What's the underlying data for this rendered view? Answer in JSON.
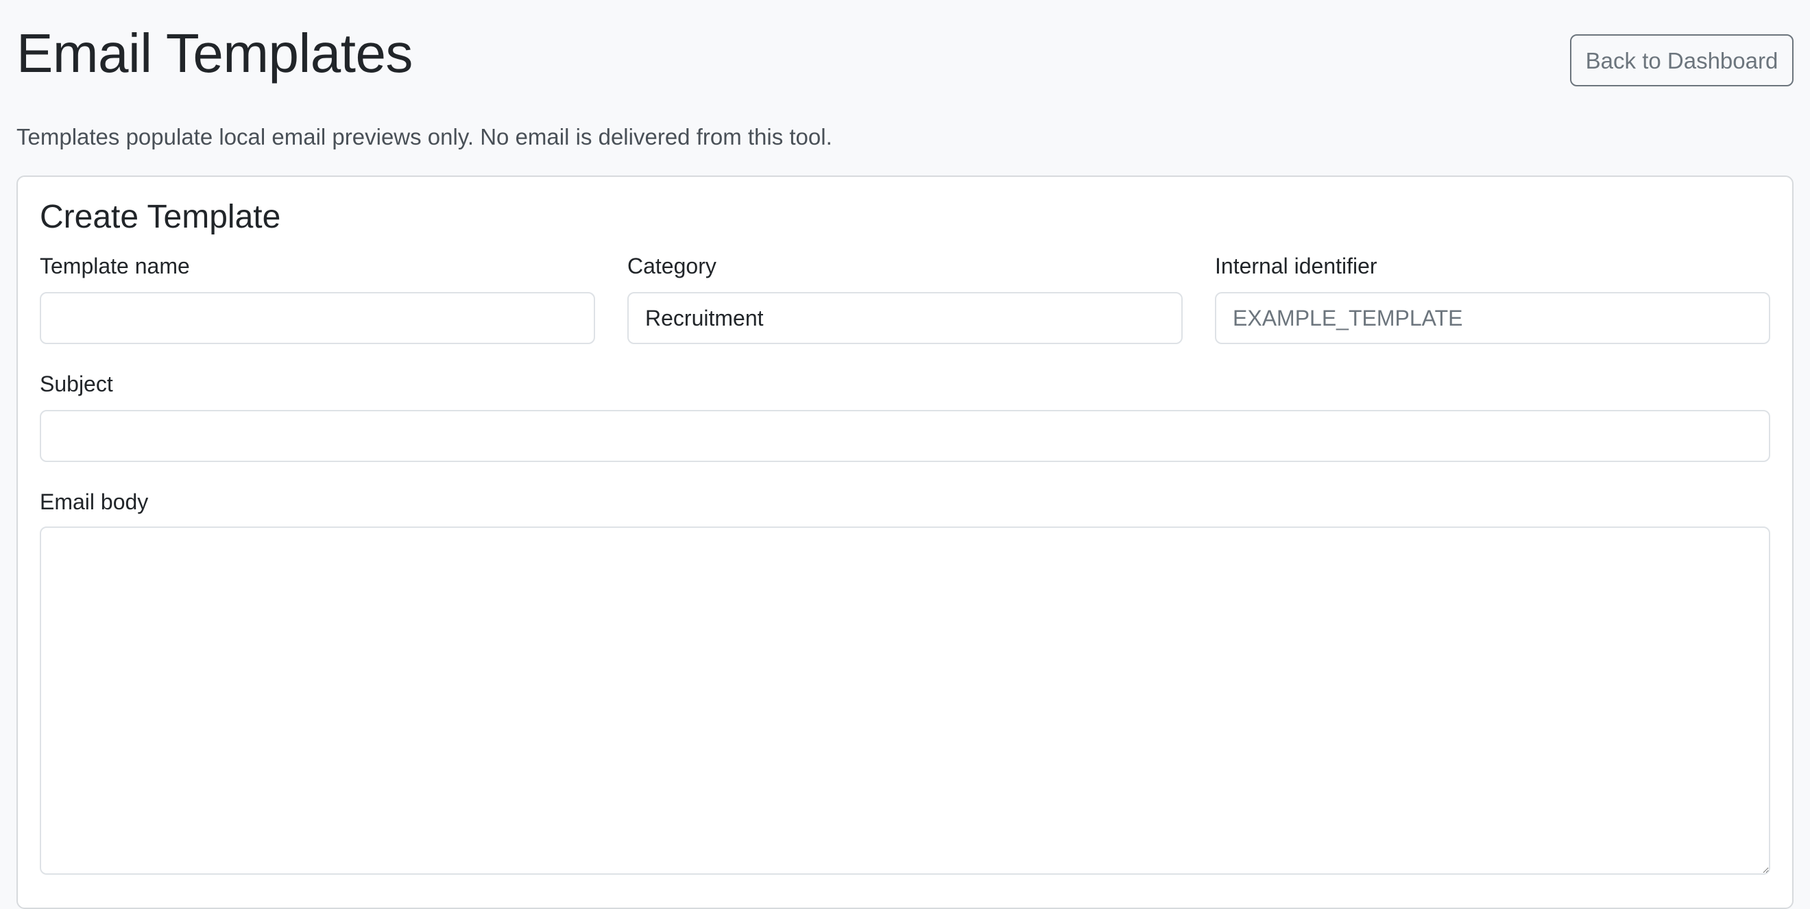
{
  "header": {
    "title": "Email Templates",
    "back_button_label": "Back to Dashboard"
  },
  "note": "Templates populate local email previews only. No email is delivered from this tool.",
  "form": {
    "title": "Create Template",
    "template_name": {
      "label": "Template name",
      "value": ""
    },
    "category": {
      "label": "Category",
      "value": "Recruitment"
    },
    "internal_identifier": {
      "label": "Internal identifier",
      "value": "",
      "placeholder": "EXAMPLE_TEMPLATE"
    },
    "subject": {
      "label": "Subject",
      "value": ""
    },
    "email_body": {
      "label": "Email body",
      "value": ""
    }
  }
}
